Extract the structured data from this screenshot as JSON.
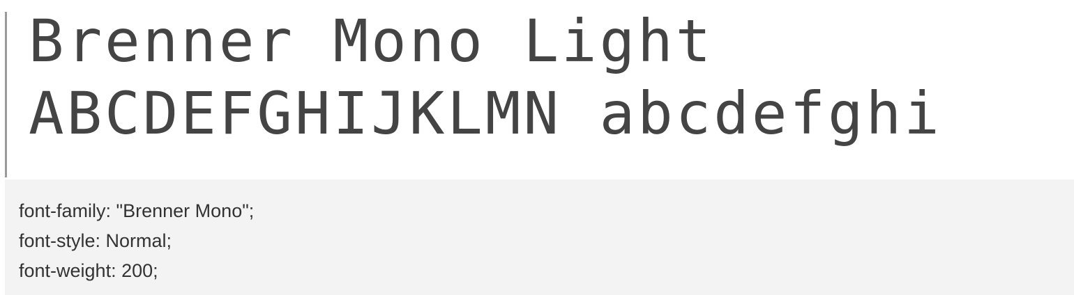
{
  "specimen": {
    "line1": "Brenner Mono Light",
    "line2": "ABCDEFGHIJKLMN abcdefghi"
  },
  "css": {
    "font_family": "font-family: \"Brenner Mono\";",
    "font_style": "font-style: Normal;",
    "font_weight": "font-weight: 200;"
  }
}
